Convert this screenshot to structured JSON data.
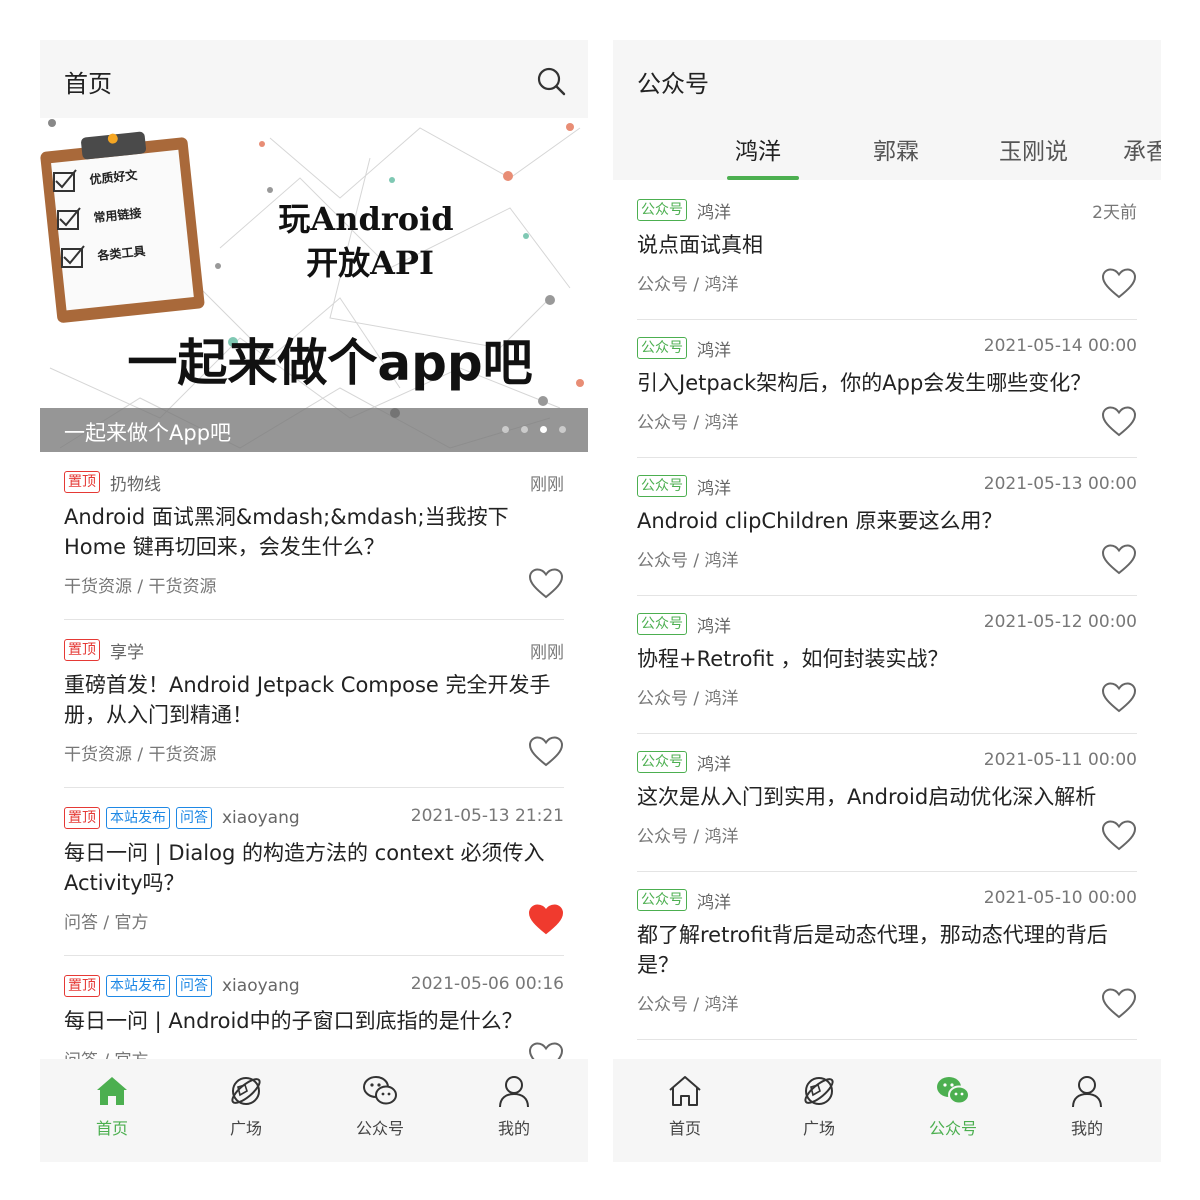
{
  "left": {
    "title": "首页",
    "banner": {
      "caption": "一起来做个App吧",
      "clipboard_items": [
        "优质好文",
        "常用链接",
        "各类工具"
      ],
      "headline_line1": "玩Android",
      "headline_line2": "开放API",
      "slogan": "一起来做个app吧",
      "dots": 4,
      "active_dot": 3
    },
    "articles": [
      {
        "badges": [
          {
            "text": "置顶",
            "color": "red"
          }
        ],
        "author": "扔物线",
        "time": "刚刚",
        "title": "Android 面试黑洞&mdash;&mdash;当我按下 Home 键再切回来，会发生什么？",
        "category": "干货资源 / 干货资源",
        "liked": false
      },
      {
        "badges": [
          {
            "text": "置顶",
            "color": "red"
          }
        ],
        "author": "享学",
        "time": "刚刚",
        "title": "重磅首发！Android Jetpack Compose 完全开发手册，从入门到精通！",
        "category": "干货资源 / 干货资源",
        "liked": false
      },
      {
        "badges": [
          {
            "text": "置顶",
            "color": "red"
          },
          {
            "text": "本站发布",
            "color": "blue"
          },
          {
            "text": "问答",
            "color": "blue"
          }
        ],
        "author": "xiaoyang",
        "time": "2021-05-13 21:21",
        "title": "每日一问 | Dialog 的构造方法的 context 必须传入 Activity吗？",
        "category": "问答 / 官方",
        "liked": true
      },
      {
        "badges": [
          {
            "text": "置顶",
            "color": "red"
          },
          {
            "text": "本站发布",
            "color": "blue"
          },
          {
            "text": "问答",
            "color": "blue"
          }
        ],
        "author": "xiaoyang",
        "time": "2021-05-06 00:16",
        "title": "每日一问 | Android中的子窗口到底指的是什么？",
        "category": "问答 / 官方",
        "liked": false
      }
    ],
    "nav": [
      {
        "label": "首页",
        "icon": "home-icon",
        "active": true
      },
      {
        "label": "广场",
        "icon": "planet-icon",
        "active": false
      },
      {
        "label": "公众号",
        "icon": "wechat-icon",
        "active": false
      },
      {
        "label": "我的",
        "icon": "person-icon",
        "active": false
      }
    ]
  },
  "right": {
    "title": "公众号",
    "tabs": [
      "鸿洋",
      "郭霖",
      "玉刚说",
      "承香"
    ],
    "active_tab": 0,
    "articles": [
      {
        "badge": "公众号",
        "author": "鸿洋",
        "time": "2天前",
        "title": "说点面试真相",
        "category": "公众号 / 鸿洋"
      },
      {
        "badge": "公众号",
        "author": "鸿洋",
        "time": "2021-05-14 00:00",
        "title": "引入Jetpack架构后，你的App会发生哪些变化？",
        "category": "公众号 / 鸿洋"
      },
      {
        "badge": "公众号",
        "author": "鸿洋",
        "time": "2021-05-13 00:00",
        "title": "Android clipChildren 原来要这么用？",
        "category": "公众号 / 鸿洋"
      },
      {
        "badge": "公众号",
        "author": "鸿洋",
        "time": "2021-05-12 00:00",
        "title": "协程+Retrofit ，如何封装实战？",
        "category": "公众号 / 鸿洋"
      },
      {
        "badge": "公众号",
        "author": "鸿洋",
        "time": "2021-05-11 00:00",
        "title": "这次是从入门到实用，Android启动优化深入解析",
        "category": "公众号 / 鸿洋"
      },
      {
        "badge": "公众号",
        "author": "鸿洋",
        "time": "2021-05-10 00:00",
        "title": "都了解retrofit背后是动态代理，那动态代理的背后是？",
        "category": "公众号 / 鸿洋"
      }
    ],
    "nav": [
      {
        "label": "首页",
        "icon": "home-icon",
        "active": false
      },
      {
        "label": "广场",
        "icon": "planet-icon",
        "active": false
      },
      {
        "label": "公众号",
        "icon": "wechat-icon",
        "active": true
      },
      {
        "label": "我的",
        "icon": "person-icon",
        "active": false
      }
    ]
  },
  "colors": {
    "accent": "#4caf50",
    "badge_red": "#e53935",
    "badge_blue": "#1e88e5",
    "heart_red": "#f03a2e"
  }
}
